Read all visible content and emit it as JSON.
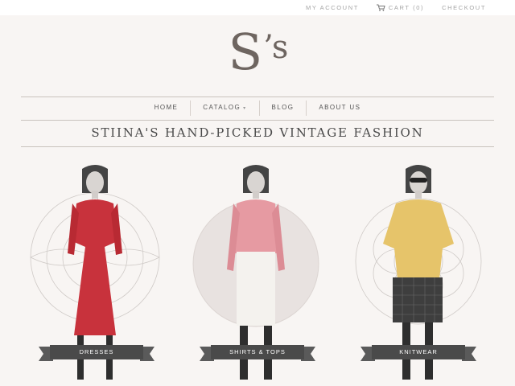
{
  "topbar": {
    "my_account": "MY ACCOUNT",
    "cart": "CART (0)",
    "checkout": "CHECKOUT"
  },
  "logo": {
    "main": "S",
    "apos": "’s"
  },
  "nav": {
    "home": "HOME",
    "catalog": "CATALOG",
    "blog": "BLOG",
    "about": "ABOUT US"
  },
  "tagline": "STIINA'S HAND-PICKED VINTAGE FASHION",
  "categories": [
    {
      "label": "DRESSES",
      "accent": "#c8323c"
    },
    {
      "label": "SHIRTS & TOPS",
      "accent": "#e69aa2"
    },
    {
      "label": "KNITWEAR",
      "accent": "#e6c46a"
    }
  ]
}
